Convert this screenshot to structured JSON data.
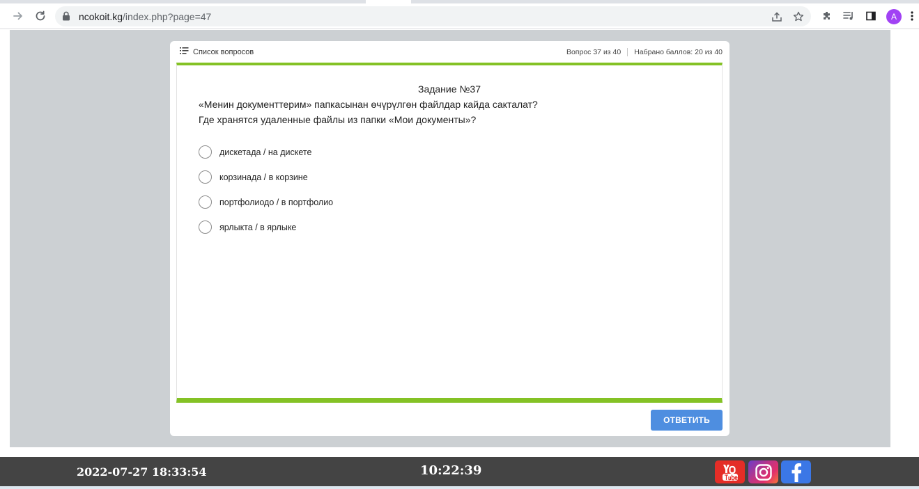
{
  "browser": {
    "url_host": "ncokoit.kg",
    "url_path": "/index.php?page=47",
    "profile_initial": "A"
  },
  "quiz": {
    "question_list_label": "Список вопросов",
    "progress": "Вопрос 37 из 40",
    "score": "Набрано баллов: 20 из 40",
    "title": "Задание №37",
    "question_ky": "«Менин документтерим» папкасынан өчүрүлгөн файлдар кайда сакталат?",
    "question_ru": "Где хранятся удаленные файлы из папки «Мои документы»?",
    "options": [
      {
        "label": "дискетада / на дискете"
      },
      {
        "label": "корзинада / в корзине"
      },
      {
        "label": "портфолиодо / в портфолио"
      },
      {
        "label": "ярлыкта / в ярлыке"
      }
    ],
    "answer_button": "ОТВЕТИТЬ"
  },
  "footer": {
    "datetime": "2022-07-27 18:33:54",
    "timer": "10:22:39"
  },
  "colors": {
    "accent_green": "#84c225",
    "button_blue": "#4e8ee0",
    "page_gray": "#ccd0d3",
    "footer_bg": "#444444"
  }
}
